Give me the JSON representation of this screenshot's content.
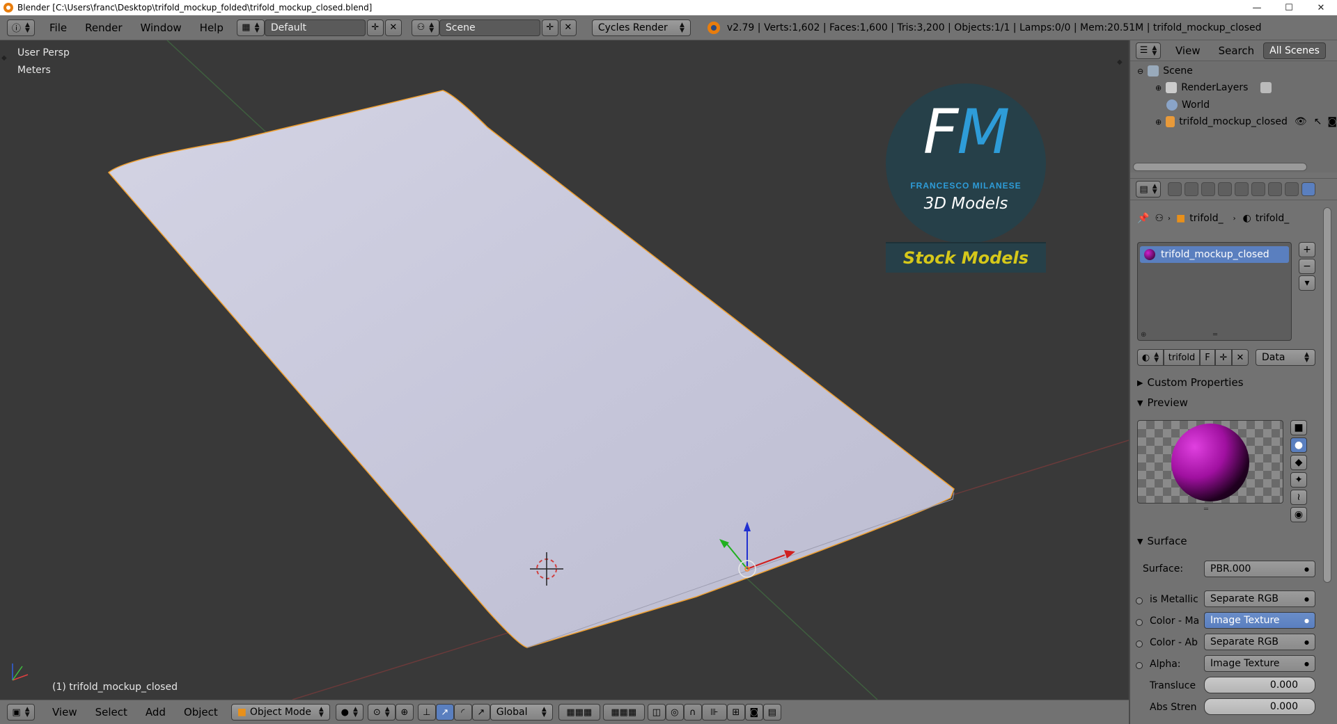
{
  "titlebar": {
    "title": "Blender [C:\\Users\\franc\\Desktop\\trifold_mockup_folded\\trifold_mockup_closed.blend]",
    "min": "—",
    "max": "☐",
    "close": "✕"
  },
  "menu": {
    "file": "File",
    "render": "Render",
    "window": "Window",
    "help": "Help"
  },
  "screen": {
    "layout": "Default",
    "scene": "Scene",
    "engine": "Cycles Render"
  },
  "stats": "v2.79 | Verts:1,602 | Faces:1,600 | Tris:3,200 | Objects:1/1 | Lamps:0/0 | Mem:20.51M | trifold_mockup_closed",
  "viewport": {
    "view_name": "User Persp",
    "units": "Meters",
    "object_info": "(1) trifold_mockup_closed"
  },
  "logo": {
    "initials": "FM",
    "name": "FRANCESCO MILANESE",
    "subtitle": "3D Models",
    "banner": "Stock Models"
  },
  "bottombar": {
    "view": "View",
    "select": "Select",
    "add": "Add",
    "object": "Object",
    "mode": "Object Mode",
    "orientation": "Global"
  },
  "outliner": {
    "view": "View",
    "search": "Search",
    "filter": "All Scenes",
    "items": [
      {
        "label": "Scene"
      },
      {
        "label": "RenderLayers"
      },
      {
        "label": "World"
      },
      {
        "label": "trifold_mockup_closed"
      }
    ]
  },
  "properties": {
    "breadcrumb1": "trifold_",
    "breadcrumb2": "trifold_",
    "material_slot": "trifold_mockup_closed",
    "material_name": "trifold",
    "fake_user": "F",
    "link": "Data",
    "custom_properties": "Custom Properties",
    "preview": "Preview",
    "surface_section": "Surface",
    "surface_label": "Surface:",
    "surface_value": "PBR.000",
    "inputs": [
      {
        "label": "is Metallic",
        "value": "Separate RGB"
      },
      {
        "label": "Color - Ma",
        "value": "Image Texture"
      },
      {
        "label": "Color - Ab",
        "value": "Separate RGB"
      },
      {
        "label": "Alpha:",
        "value": "Image Texture"
      }
    ],
    "translucency_label": "Transluce",
    "translucency_value": "0.000",
    "abs_label": "Abs Stren",
    "abs_value": "0.000"
  },
  "colors": {
    "accent": "#5a7fbf",
    "paper": "#c9c9de",
    "selection": "#f0a030"
  }
}
